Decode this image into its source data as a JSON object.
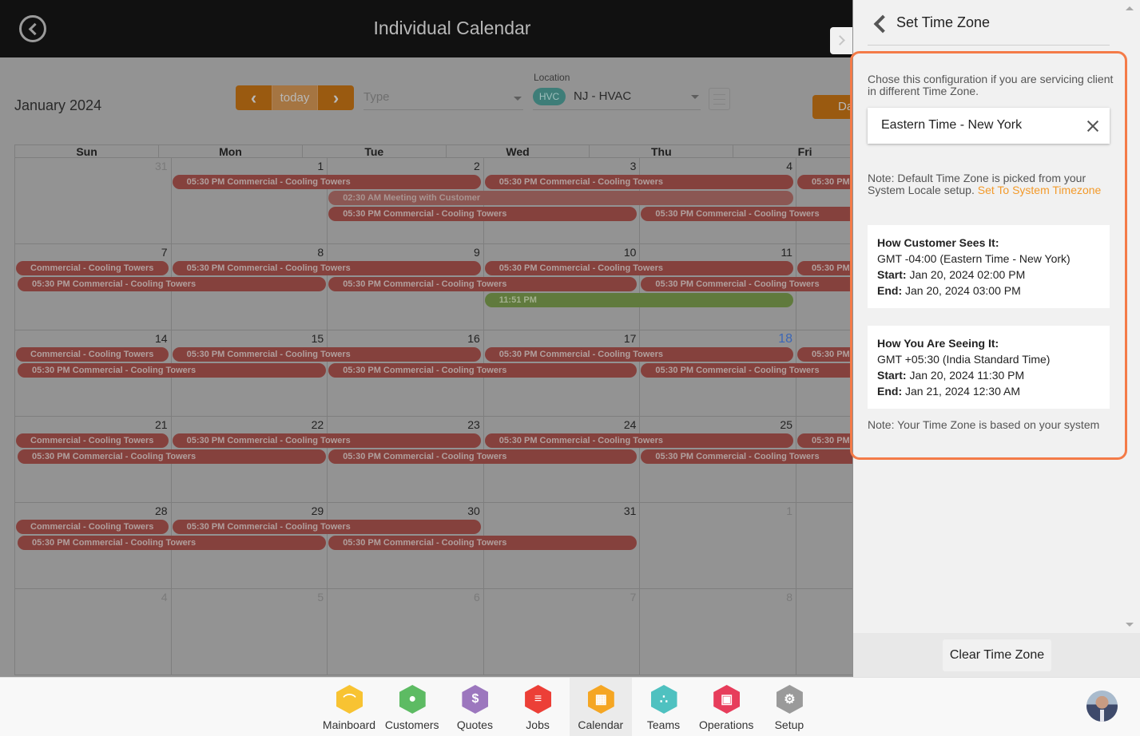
{
  "header": {
    "title": "Individual Calendar",
    "back_icon": "circle-chevron-left-icon"
  },
  "toolbar": {
    "month_title": "January 2024",
    "prev_label": "‹",
    "today_label": "today",
    "next_label": "›",
    "type_placeholder": "Type",
    "location_label": "Location",
    "location_badge": "HVC",
    "location_value": "NJ - HVAC",
    "day_button_label": "Da"
  },
  "calendar": {
    "days_of_week": [
      "Sun",
      "Mon",
      "Tue",
      "Wed",
      "Thu",
      "Fri"
    ],
    "weeks": [
      {
        "days": [
          {
            "n": "31",
            "other": true
          },
          {
            "n": "1"
          },
          {
            "n": "2"
          },
          {
            "n": "3"
          },
          {
            "n": "4"
          },
          {
            "n": ""
          }
        ],
        "events": [
          {
            "title": "05:30 PM Commercial - Cooling Towers",
            "start": 1,
            "span": 2,
            "row": 0
          },
          {
            "title": "05:30 PM Commercial - Cooling Towers",
            "start": 3,
            "span": 2,
            "row": 0
          },
          {
            "title": "05:30 PM",
            "start": 5,
            "span": 1,
            "row": 0
          },
          {
            "title": "02:30 AM Meeting with Customer",
            "start": 2,
            "span": 3,
            "row": 1,
            "style": "light"
          },
          {
            "title": "05:30 PM Commercial - Cooling Towers",
            "start": 2,
            "span": 2,
            "row": 2
          },
          {
            "title": "05:30 PM Commercial - Cooling Towers",
            "start": 4,
            "span": 2,
            "row": 2
          }
        ]
      },
      {
        "days": [
          {
            "n": "7"
          },
          {
            "n": "8"
          },
          {
            "n": "9"
          },
          {
            "n": "10"
          },
          {
            "n": "11"
          },
          {
            "n": ""
          }
        ],
        "events": [
          {
            "title": "Commercial - Cooling Towers",
            "start": 0,
            "span": 1,
            "row": 0
          },
          {
            "title": "05:30 PM Commercial - Cooling Towers",
            "start": 1,
            "span": 2,
            "row": 0
          },
          {
            "title": "05:30 PM Commercial - Cooling Towers",
            "start": 3,
            "span": 2,
            "row": 0
          },
          {
            "title": "05:30 PM",
            "start": 5,
            "span": 1,
            "row": 0
          },
          {
            "title": "05:30 PM Commercial - Cooling Towers",
            "start": 0,
            "span": 2,
            "row": 1
          },
          {
            "title": "05:30 PM Commercial - Cooling Towers",
            "start": 2,
            "span": 2,
            "row": 1
          },
          {
            "title": "05:30 PM Commercial - Cooling Towers",
            "start": 4,
            "span": 2,
            "row": 1
          },
          {
            "title": "11:51 PM",
            "start": 3,
            "span": 2,
            "row": 2,
            "style": "green"
          }
        ]
      },
      {
        "days": [
          {
            "n": "14"
          },
          {
            "n": "15"
          },
          {
            "n": "16"
          },
          {
            "n": "17"
          },
          {
            "n": "18",
            "today": true
          },
          {
            "n": ""
          }
        ],
        "events": [
          {
            "title": "Commercial - Cooling Towers",
            "start": 0,
            "span": 1,
            "row": 0
          },
          {
            "title": "05:30 PM Commercial - Cooling Towers",
            "start": 1,
            "span": 2,
            "row": 0
          },
          {
            "title": "05:30 PM Commercial - Cooling Towers",
            "start": 3,
            "span": 2,
            "row": 0
          },
          {
            "title": "05:30 PM",
            "start": 5,
            "span": 1,
            "row": 0
          },
          {
            "title": "05:30 PM Commercial - Cooling Towers",
            "start": 0,
            "span": 2,
            "row": 1
          },
          {
            "title": "05:30 PM Commercial - Cooling Towers",
            "start": 2,
            "span": 2,
            "row": 1
          },
          {
            "title": "05:30 PM Commercial - Cooling Towers",
            "start": 4,
            "span": 2,
            "row": 1
          }
        ]
      },
      {
        "days": [
          {
            "n": "21"
          },
          {
            "n": "22"
          },
          {
            "n": "23"
          },
          {
            "n": "24"
          },
          {
            "n": "25"
          },
          {
            "n": ""
          }
        ],
        "events": [
          {
            "title": "Commercial - Cooling Towers",
            "start": 0,
            "span": 1,
            "row": 0
          },
          {
            "title": "05:30 PM Commercial - Cooling Towers",
            "start": 1,
            "span": 2,
            "row": 0
          },
          {
            "title": "05:30 PM Commercial - Cooling Towers",
            "start": 3,
            "span": 2,
            "row": 0
          },
          {
            "title": "05:30 PM",
            "start": 5,
            "span": 1,
            "row": 0
          },
          {
            "title": "05:30 PM Commercial - Cooling Towers",
            "start": 0,
            "span": 2,
            "row": 1
          },
          {
            "title": "05:30 PM Commercial - Cooling Towers",
            "start": 2,
            "span": 2,
            "row": 1
          },
          {
            "title": "05:30 PM Commercial - Cooling Towers",
            "start": 4,
            "span": 2,
            "row": 1
          }
        ]
      },
      {
        "days": [
          {
            "n": "28"
          },
          {
            "n": "29"
          },
          {
            "n": "30"
          },
          {
            "n": "31"
          },
          {
            "n": "1",
            "other": true
          },
          {
            "n": ""
          }
        ],
        "events": [
          {
            "title": "Commercial - Cooling Towers",
            "start": 0,
            "span": 1,
            "row": 0
          },
          {
            "title": "05:30 PM Commercial - Cooling Towers",
            "start": 1,
            "span": 2,
            "row": 0
          },
          {
            "title": "05:30 PM Commercial - Cooling Towers",
            "start": 0,
            "span": 2,
            "row": 1
          },
          {
            "title": "05:30 PM Commercial - Cooling Towers",
            "start": 2,
            "span": 2,
            "row": 1
          }
        ]
      },
      {
        "days": [
          {
            "n": "4",
            "other": true
          },
          {
            "n": "5",
            "other": true
          },
          {
            "n": "6",
            "other": true
          },
          {
            "n": "7",
            "other": true
          },
          {
            "n": "8",
            "other": true
          },
          {
            "n": ""
          }
        ],
        "events": []
      }
    ]
  },
  "timezone_panel": {
    "title": "Set Time Zone",
    "description": "Chose this configuration if you are servicing client in different Time Zone.",
    "selected_timezone": "Eastern Time - New York",
    "note_prefix": "Note: Default Time Zone is picked from your System Locale setup.",
    "note_link": "Set To System Timezone",
    "customer_view": {
      "heading": "How Customer Sees It:",
      "zone": "GMT -04:00 (Eastern Time - New York)",
      "start_label": "Start:",
      "start_value": "Jan 20, 2024 02:00 PM",
      "end_label": "End:",
      "end_value": "Jan 20, 2024 03:00 PM"
    },
    "your_view": {
      "heading": "How You Are Seeing It:",
      "zone": "GMT +05:30 (India Standard Time)",
      "start_label": "Start:",
      "start_value": "Jan 20, 2024 11:30 PM",
      "end_label": "End:",
      "end_value": "Jan 21, 2024 12:30 AM"
    },
    "footer_note": "Note: Your Time Zone is based on your system",
    "clear_button": "Clear Time Zone",
    "accent_color": "#f47b48",
    "link_color": "#f39a2a"
  },
  "bottom_nav": {
    "items": [
      {
        "label": "Mainboard",
        "icon": "mainboard-icon",
        "color": "#f8c332",
        "glyph": "⌒"
      },
      {
        "label": "Customers",
        "icon": "customer-icon",
        "color": "#5dbb63",
        "glyph": "●"
      },
      {
        "label": "Quotes",
        "icon": "quotes-icon",
        "color": "#9c77be",
        "glyph": "$"
      },
      {
        "label": "Jobs",
        "icon": "jobs-list-icon",
        "color": "#ec3f37",
        "glyph": "≡"
      },
      {
        "label": "Calendar",
        "icon": "calendar-icon",
        "color": "#f5a623",
        "glyph": "▦",
        "active": true
      },
      {
        "label": "Teams",
        "icon": "teams-icon",
        "color": "#4fc1c0",
        "glyph": "∴"
      },
      {
        "label": "Operations",
        "icon": "operations-icon",
        "color": "#e73d5b",
        "glyph": "▣"
      },
      {
        "label": "Setup",
        "icon": "gear-icon",
        "color": "#9a9a9a",
        "glyph": "⚙"
      }
    ]
  }
}
